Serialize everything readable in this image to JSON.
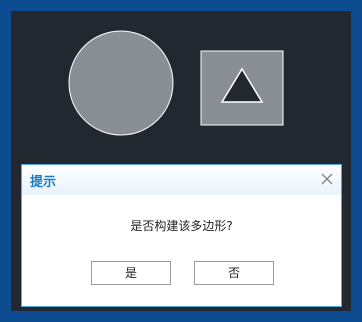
{
  "dialog": {
    "title": "提示",
    "message": "是否构建该多边形?",
    "yes_label": "是",
    "no_label": "否"
  },
  "colors": {
    "frame": "#0e4c92",
    "canvas": "#222830",
    "shape_fill": "#8a8e95",
    "shape_stroke": "#ffffff",
    "title": "#1a7bc4",
    "dialog_border": "#55a8e0"
  },
  "icons": {
    "close": "close-icon"
  }
}
